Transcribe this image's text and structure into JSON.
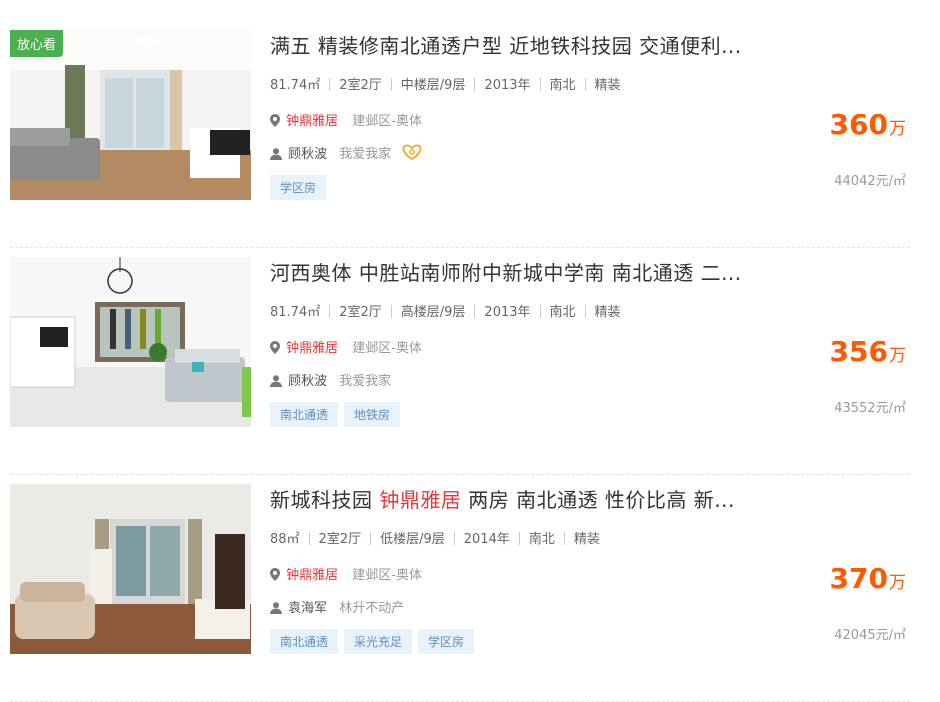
{
  "listings": [
    {
      "badge": "放心看",
      "title": "满五 精装修南北通透户型 近地铁科技园 交通便利...",
      "area": "81.74㎡",
      "layout": "2室2厅",
      "floor": "中楼层/9层",
      "year": "2013年",
      "orientation": "南北",
      "decoration": "精装",
      "community": "钟鼎雅居",
      "district": "建邺区-奥体",
      "agent": "顾秋波",
      "company": "我爱我家",
      "tags": [
        "学区房"
      ],
      "price": "360",
      "price_unit": "万",
      "unit_price": "44042元/㎡"
    },
    {
      "title": "河西奥体 中胜站南师附中新城中学南 南北通透 二...",
      "area": "81.74㎡",
      "layout": "2室2厅",
      "floor": "高楼层/9层",
      "year": "2013年",
      "orientation": "南北",
      "decoration": "精装",
      "community": "钟鼎雅居",
      "district": "建邺区-奥体",
      "agent": "顾秋波",
      "company": "我爱我家",
      "tags": [
        "南北通透",
        "地铁房"
      ],
      "price": "356",
      "price_unit": "万",
      "unit_price": "43552元/㎡"
    },
    {
      "title_pre": "新城科技园 ",
      "title_hl": "钟鼎雅居",
      "title_post": " 两房 南北通透 性价比高 新...",
      "area": "88㎡",
      "layout": "2室2厅",
      "floor": "低楼层/9层",
      "year": "2014年",
      "orientation": "南北",
      "decoration": "精装",
      "community": "钟鼎雅居",
      "district": "建邺区-奥体",
      "agent": "袁海军",
      "company": "林升不动产",
      "tags": [
        "南北通透",
        "采光充足",
        "学区房"
      ],
      "price": "370",
      "price_unit": "万",
      "unit_price": "42045元/㎡"
    }
  ],
  "colors": {
    "accent_price": "#ff5a00",
    "highlight": "#e4393c",
    "badge": "#4caf50",
    "tag_bg": "#e8f2fb"
  },
  "icons": {
    "location": "map-pin-icon",
    "agent": "person-icon",
    "verified": "heart-badge-icon"
  }
}
